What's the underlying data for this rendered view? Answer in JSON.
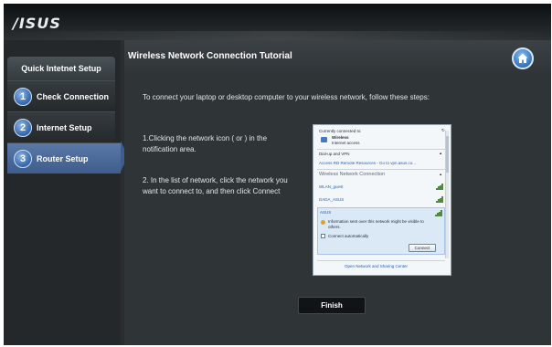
{
  "header": {
    "logo": "/ISUS"
  },
  "sidebar": {
    "title": "Quick Intetnet Setup",
    "steps": [
      {
        "number": "1",
        "label": "Check Connection"
      },
      {
        "number": "2",
        "label": "Internet Setup"
      },
      {
        "number": "3",
        "label": "Router Setup"
      }
    ],
    "active_step": 3
  },
  "main": {
    "title": "Wireless Network Connection Tutorial",
    "home_icon": "home-icon",
    "intro": "To connect your laptop or desktop computer to your wireless network, follow these steps:",
    "step1": "1.Clicking the network icon ( or ) in the notification area.",
    "step2": "2. In the list of network, click the network you want to connect to, and then click Connect",
    "finish_label": "Finish"
  },
  "flyout": {
    "currently_connected": "Currently connected to:",
    "wireless": "Wireless",
    "internet_access": "Internet access",
    "dialup": "Dial-up and VPN",
    "remote": "Access RD Remote Resources - Go to vpn.asus.co...",
    "wireless_section": "Wireless Network Connection",
    "networks": [
      "WLAN_guest",
      "DADA_ASUS",
      "ASUS"
    ],
    "warning": "Information sent over this network might be visible to others.",
    "auto": "Connect automatically",
    "connect": "Connect",
    "footer": "Open Network and Sharing Center"
  },
  "colors": {
    "accent": "#3e5c8c",
    "background": "#2f3437",
    "header": "#1d2124"
  }
}
